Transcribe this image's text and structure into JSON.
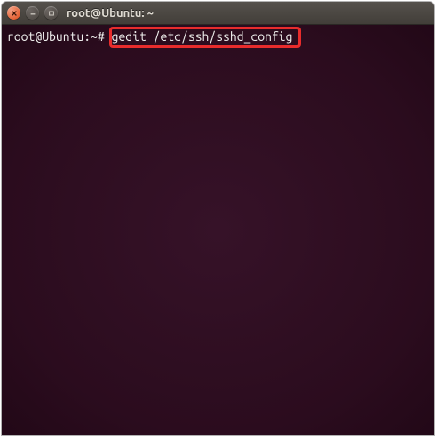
{
  "titlebar": {
    "title": "root@Ubuntu: ~"
  },
  "terminal": {
    "prompt": "root@Ubuntu:~#",
    "command": "gedit /etc/ssh/sshd_config"
  }
}
